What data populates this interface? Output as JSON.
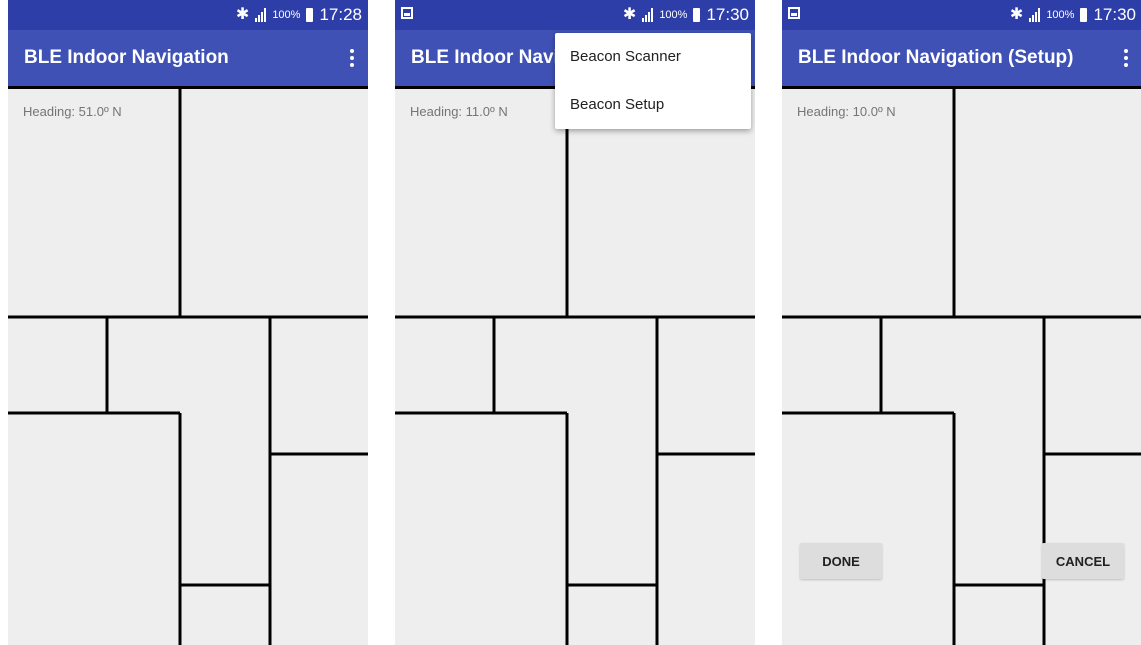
{
  "colors": {
    "status_bar": "#2e3ea8",
    "toolbar": "#3f51b5",
    "floor": "#eeeeee",
    "walls": "#000000"
  },
  "screens": [
    {
      "status": {
        "battery": "100%",
        "time": "17:28"
      },
      "title": "BLE Indoor Navigation",
      "heading": "Heading: 51.0º N"
    },
    {
      "status": {
        "battery": "100%",
        "time": "17:30"
      },
      "title": "BLE Indoor Navigation",
      "heading": "Heading: 11.0º N",
      "menu": [
        "Beacon Scanner",
        "Beacon Setup"
      ]
    },
    {
      "status": {
        "battery": "100%",
        "time": "17:30"
      },
      "title": "BLE Indoor Navigation (Setup)",
      "heading": "Heading: 10.0º N",
      "buttons": {
        "done": "DONE",
        "cancel": "CANCEL"
      }
    }
  ]
}
